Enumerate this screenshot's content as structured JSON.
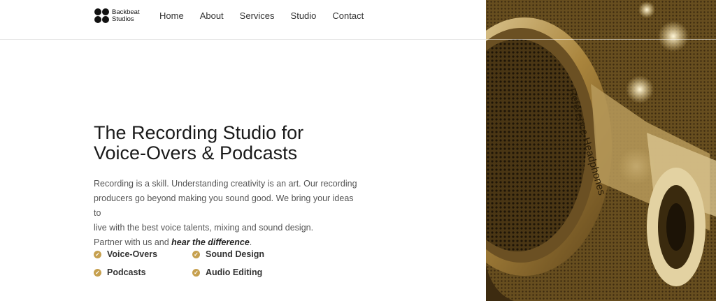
{
  "brand": {
    "name_line1": "Backbeat",
    "name_line2": "Studios"
  },
  "nav": {
    "items": [
      "Home",
      "About",
      "Services",
      "Studio",
      "Contact"
    ]
  },
  "hero": {
    "title_line1": "The Recording Studio for",
    "title_line2": "Voice-Overs & Podcasts",
    "desc_line1": "Recording is a skill. Understanding creativity is an art. Our recording",
    "desc_line2": "producers go beyond making you sound good. We bring your ideas to",
    "desc_line3": "live with the best voice talents, mixing and sound design.",
    "desc_line4_prefix": "Partner with us and ",
    "desc_line4_emphasis": "hear the difference",
    "desc_line4_suffix": "."
  },
  "features": {
    "items": [
      "Voice-Overs",
      "Sound Design",
      "Podcasts",
      "Audio Editing"
    ],
    "check_glyph": "✓"
  },
  "image": {
    "headphone_text": "Reference Headphones"
  },
  "colors": {
    "accent": "#c6a04f",
    "text": "#222222",
    "muted": "#555555"
  }
}
